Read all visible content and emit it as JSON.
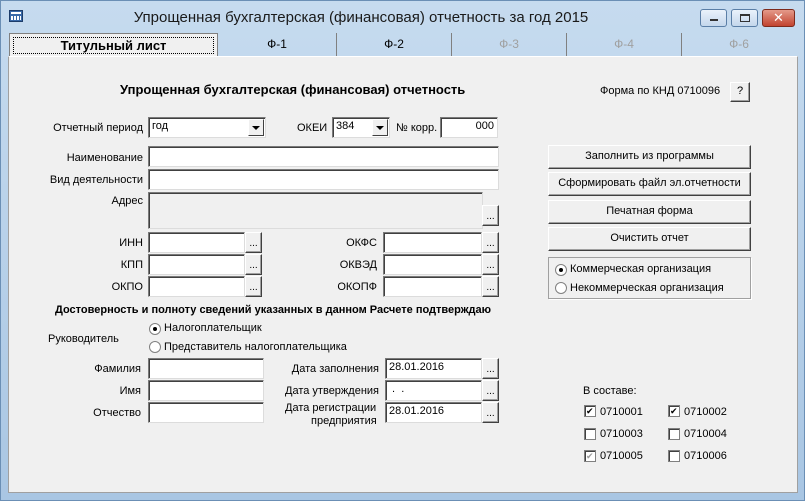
{
  "window": {
    "title": "Упрощенная бухгалтерская (финансовая) отчетность за год 2015",
    "min_glyph": "",
    "close_glyph": "✕"
  },
  "tabs": [
    {
      "label": "Титульный лист",
      "state": "active"
    },
    {
      "label": "Ф-1",
      "state": "enabled"
    },
    {
      "label": "Ф-2",
      "state": "enabled"
    },
    {
      "label": "Ф-3",
      "state": "disabled"
    },
    {
      "label": "Ф-4",
      "state": "disabled"
    },
    {
      "label": "Ф-6",
      "state": "disabled"
    }
  ],
  "header": {
    "title": "Упрощенная бухгалтерская (финансовая) отчетность",
    "knd_label": "Форма по КНД 0710096",
    "help_label": "?"
  },
  "period": {
    "label": "Отчетный период",
    "value": "год",
    "okei_label": "ОКЕИ",
    "okei_value": "384",
    "corr_label": "№ корр.",
    "corr_value": "000"
  },
  "org": {
    "name_label": "Наименование",
    "name_value": "",
    "activity_label": "Вид деятельности",
    "activity_value": "",
    "address_label": "Адрес",
    "address_value": ""
  },
  "codes": {
    "inn_label": "ИНН",
    "inn_value": "",
    "kpp_label": "КПП",
    "kpp_value": "",
    "okpo_label": "ОКПО",
    "okpo_value": "",
    "okfs_label": "ОКФС",
    "okfs_value": "",
    "okved_label": "ОКВЭД",
    "okved_value": "",
    "okopf_label": "ОКОПФ",
    "okopf_value": ""
  },
  "actions": {
    "fill_label": "Заполнить из программы",
    "export_label": "Сформировать файл эл.отчетности",
    "print_label": "Печатная форма",
    "clear_label": "Очистить отчет",
    "dots_label": "..."
  },
  "org_type": {
    "options": [
      "Коммерческая организация",
      "Некоммерческая организация"
    ],
    "selected": "Коммерческая организация"
  },
  "confirm": {
    "title": "Достоверность и полноту сведений указанных в данном Расчете подтверждаю",
    "head_label": "Руководитель",
    "options": [
      "Налогоплательщик",
      "Представитель налогоплательщика"
    ],
    "selected": "Налогоплательщик"
  },
  "person": {
    "surname_label": "Фамилия",
    "surname_value": "",
    "name_label": "Имя",
    "name_value": "",
    "patronymic_label": "Отчество",
    "patronymic_value": ""
  },
  "dates": {
    "fill_label": "Дата заполнения",
    "fill_value": "28.01.2016",
    "approve_label": "Дата утверждения",
    "approve_value": " .  .",
    "reg_label_1": "Дата регистрации",
    "reg_label_2": "предприятия",
    "reg_value": "28.01.2016"
  },
  "composition": {
    "label": "В составе:",
    "forms": [
      {
        "code": "0710001",
        "checked": true,
        "enabled": true
      },
      {
        "code": "0710002",
        "checked": true,
        "enabled": true
      },
      {
        "code": "0710003",
        "checked": false,
        "enabled": true
      },
      {
        "code": "0710004",
        "checked": false,
        "enabled": true
      },
      {
        "code": "0710005",
        "checked": true,
        "enabled": false
      },
      {
        "code": "0710006",
        "checked": false,
        "enabled": true
      }
    ]
  }
}
